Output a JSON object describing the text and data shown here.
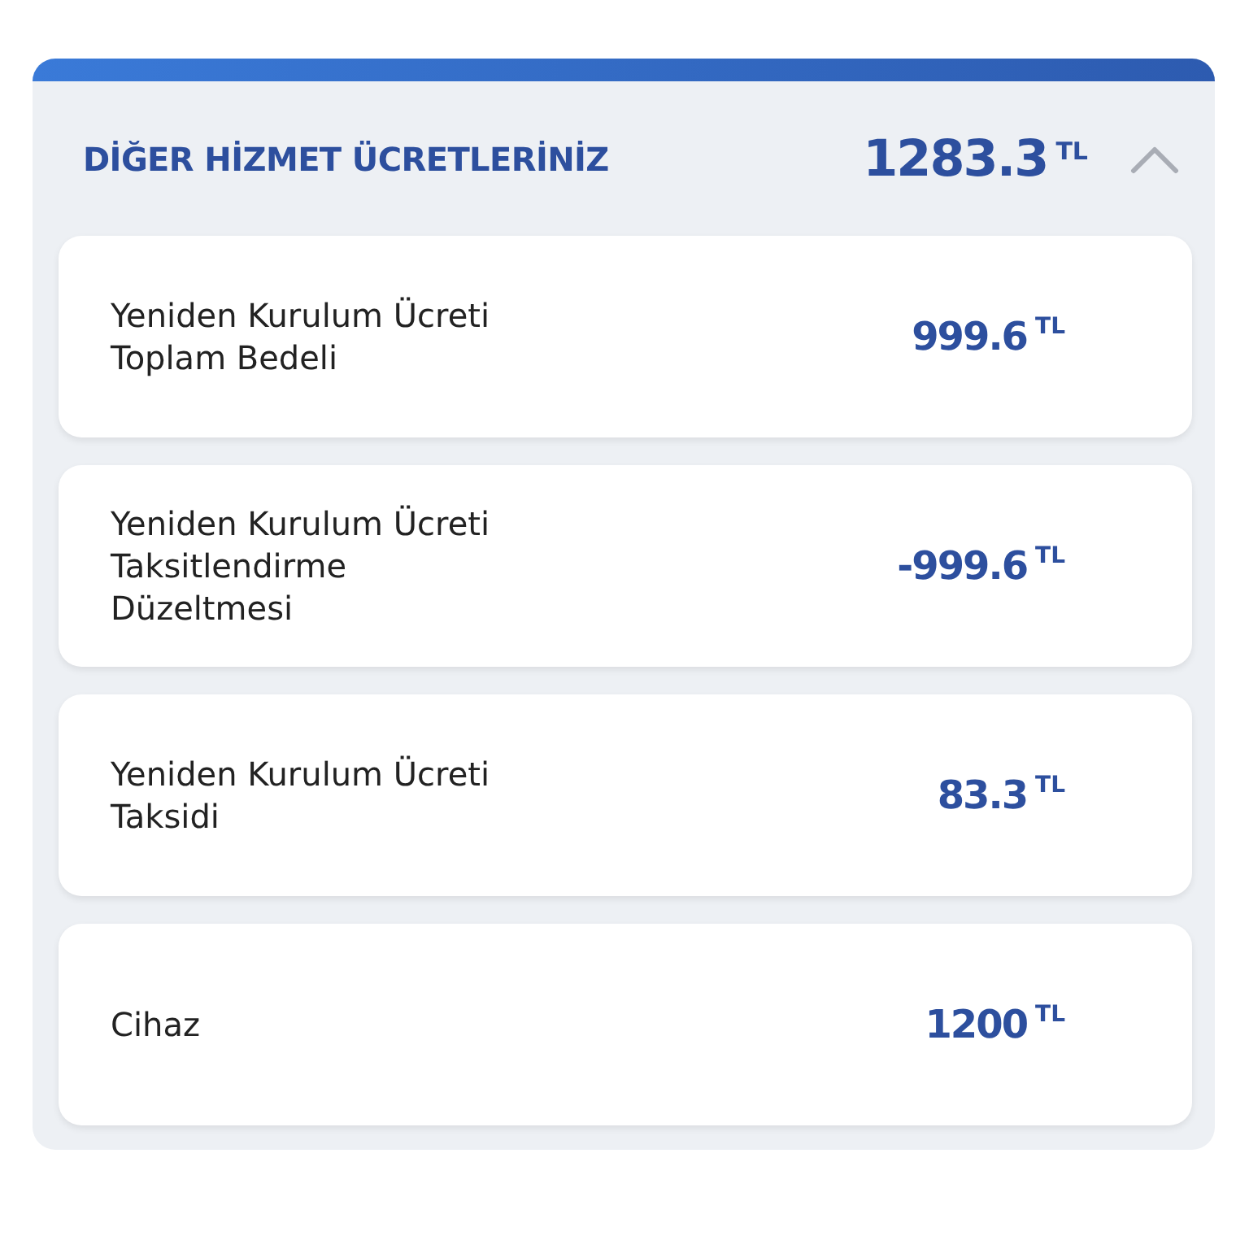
{
  "section": {
    "title": "DİĞER HİZMET ÜCRETLERİNİZ",
    "total": "1283.3",
    "currency": "TL",
    "expanded": true
  },
  "items": [
    {
      "label": "Yeniden Kurulum Ücreti Toplam Bedeli",
      "amount": "999.6",
      "currency": "TL"
    },
    {
      "label": "Yeniden Kurulum Ücreti Taksitlendirme Düzeltmesi",
      "amount": "-999.6",
      "currency": "TL"
    },
    {
      "label": "Yeniden Kurulum Ücreti Taksidi",
      "amount": "83.3",
      "currency": "TL"
    },
    {
      "label": "Cihaz",
      "amount": "1200",
      "currency": "TL"
    }
  ]
}
